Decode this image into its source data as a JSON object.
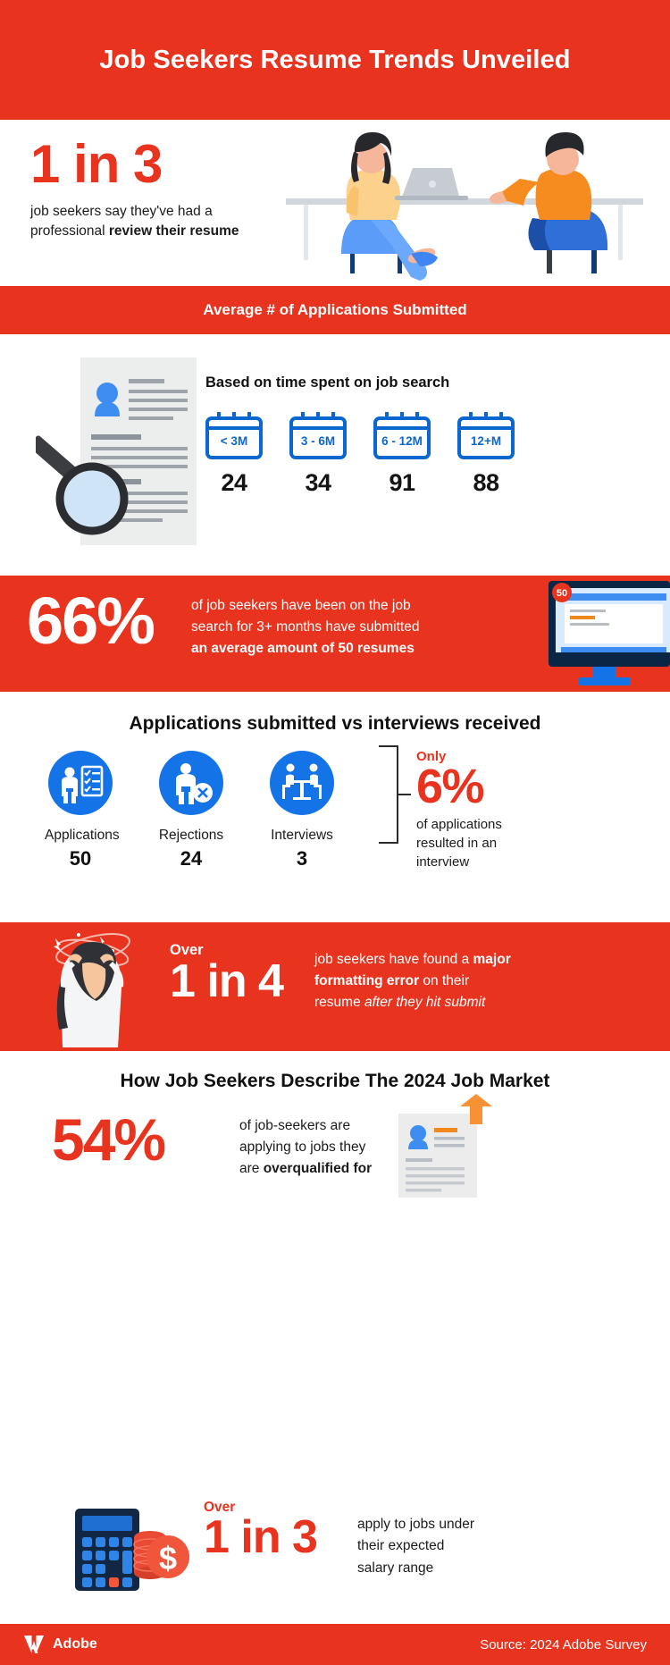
{
  "colors": {
    "brand_red": "#e8331f",
    "blue": "#1473e6",
    "cal_blue": "#0b67d0",
    "text_dark": "#1b1b1b",
    "orange": "#f79234"
  },
  "header": {
    "title": "Job Seekers Resume Trends Unveiled"
  },
  "one_in_three": {
    "big": "1 in 3",
    "line1": "job seekers say they've had a",
    "line2_plain": "professional ",
    "line2_bold": "review their resume",
    "art": "interview-desk-illustration"
  },
  "band_avg": {
    "label": "Average # of Applications Submitted"
  },
  "time_spent": {
    "title": "Based on time spent on job search",
    "resume_art": "resume-magnifier-illustration",
    "buckets": [
      {
        "label": "< 3M",
        "value": "24",
        "icon": "calendar-icon"
      },
      {
        "label": "3 - 6M",
        "value": "34",
        "icon": "calendar-icon"
      },
      {
        "label": "6 - 12M",
        "value": "91",
        "icon": "calendar-icon"
      },
      {
        "label": "12+M",
        "value": "88",
        "icon": "calendar-icon"
      }
    ]
  },
  "band_66": {
    "number": "66%",
    "line1": "of job seekers have been on the job",
    "line2": "search for 3+ months have submitted",
    "line3_bold": "an average amount of 50 resumes",
    "monitor_badge": "50",
    "art": "desktop-monitor-illustration"
  },
  "apps_vs_interviews": {
    "title": "Applications submitted vs interviews received",
    "items": [
      {
        "label": "Applications",
        "value": "50",
        "icon": "person-checklist-icon"
      },
      {
        "label": "Rejections",
        "value": "24",
        "icon": "person-rejected-icon"
      },
      {
        "label": "Interviews",
        "value": "3",
        "icon": "interview-table-icon"
      }
    ],
    "callout": {
      "only": "Only",
      "percent": "6%",
      "sub_line1": "of applications",
      "sub_line2": "resulted in an",
      "sub_line3": "interview"
    }
  },
  "band_one_in_four": {
    "over": "Over",
    "number": "1 in 4",
    "text_a": "job seekers have found a ",
    "text_a_bold": "major",
    "text_b_bold": "formatting error",
    "text_b": " on their",
    "text_c": "resume ",
    "text_c_italic": "after they hit submit",
    "art": "stressed-person-illustration"
  },
  "market": {
    "title": "How Job Seekers Describe The 2024 Job Market",
    "percent": "54%",
    "line1": "of job-seekers are",
    "line2": "applying to jobs they",
    "line3_plain": "are ",
    "line3_bold": "overqualified for",
    "art": "resume-up-arrow-illustration"
  },
  "salary": {
    "over": "Over",
    "number": "1 in 3",
    "line1": "apply to jobs under",
    "line2": "their expected",
    "line3": "salary range",
    "art": "calculator-coins-illustration"
  },
  "footer": {
    "logo_name": "adobe-logo",
    "brand": "Adobe",
    "source": "Source: 2024 Adobe Survey"
  }
}
